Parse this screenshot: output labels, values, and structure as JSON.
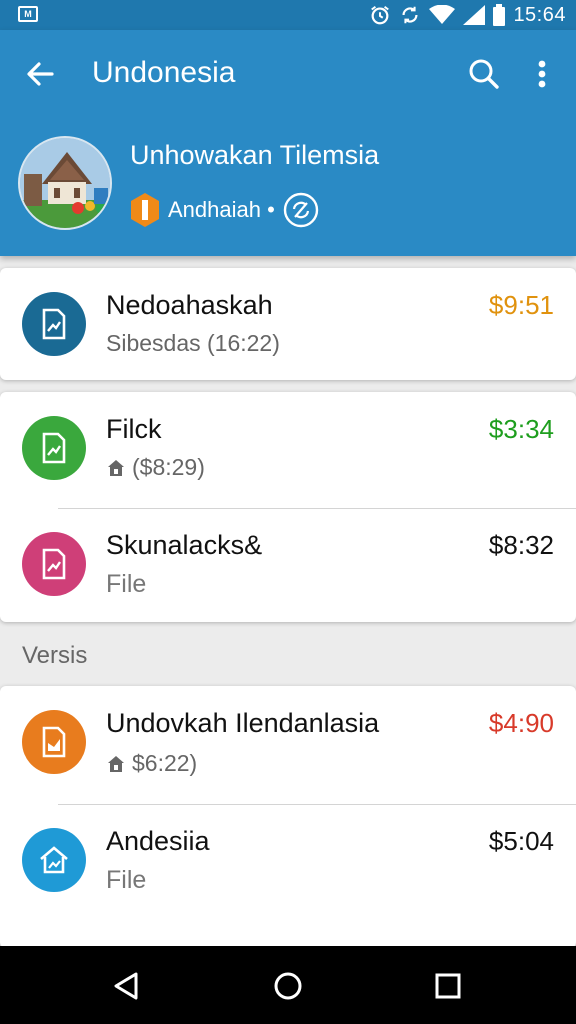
{
  "status_bar": {
    "time": "15:64",
    "left_icon": "gallery-icon",
    "icons": [
      "alarm-icon",
      "sync-icon",
      "wifi-icon",
      "signal-icon",
      "battery-icon"
    ]
  },
  "toolbar": {
    "title": "Undonesia",
    "back_icon": "back-arrow-icon",
    "search_icon": "search-icon",
    "more_icon": "more-vert-icon"
  },
  "profile": {
    "name": "Unhowakan Tilemsia",
    "meta_label": "Andhaiah •",
    "badge_icon": "hexagon-badge-icon",
    "status_icon": "sync-circle-icon"
  },
  "cards": [
    {
      "rows": [
        {
          "title": "Nedoahaskah",
          "subtitle": "Sibesdas (16:22)",
          "price": "$9:51",
          "price_color": "#e0920e",
          "icon_color": "#1a6a94",
          "icon": "file-chart-icon",
          "locked": false
        }
      ]
    },
    {
      "rows": [
        {
          "title": "Filck",
          "subtitle": "($8:29)",
          "price": "$3:34",
          "price_color": "#1e9e1e",
          "icon_color": "#3aa83d",
          "icon": "file-chart-icon",
          "locked": true
        },
        {
          "title": "Skunalacks&",
          "subtitle": "File",
          "price": "$8:32",
          "price_color": "#111111",
          "icon_color": "#cf3f78",
          "icon": "file-chart-icon",
          "locked": false
        }
      ]
    },
    {
      "rows": [
        {
          "title": "Undovkah Ilendanlasia",
          "subtitle": "$6:22)",
          "price": "$4:90",
          "price_color": "#d83a2a",
          "icon_color": "#e87c1e",
          "icon": "file-doc-icon",
          "locked": true
        },
        {
          "title": "Andesiia",
          "subtitle": "File",
          "price": "$5:04",
          "price_color": "#111111",
          "icon_color": "#1f9ad6",
          "icon": "file-home-icon",
          "locked": false
        }
      ]
    }
  ],
  "section_header": "Versis",
  "nav_bar": {
    "back_icon": "nav-back-icon",
    "home_icon": "nav-home-icon",
    "recents_icon": "nav-recents-icon"
  },
  "colors": {
    "primary": "#2a8ac5",
    "primary_dark": "#1f78ae",
    "background": "#ececec"
  }
}
